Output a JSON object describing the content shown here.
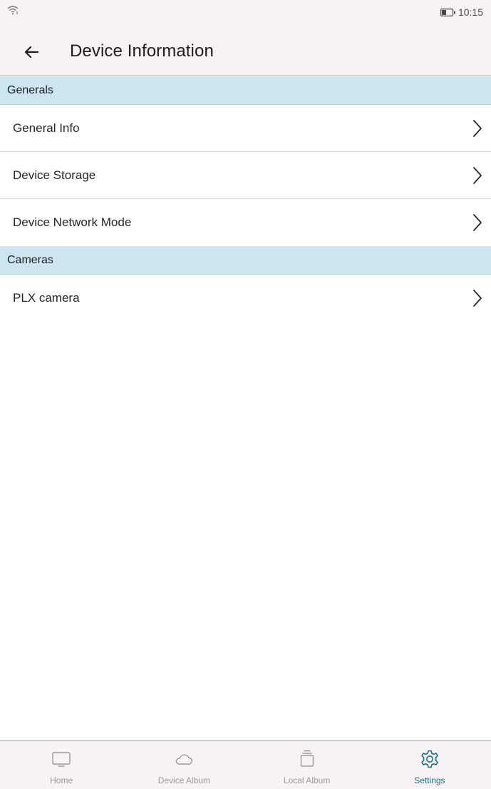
{
  "status_bar": {
    "time": "10:15"
  },
  "header": {
    "title": "Device Information",
    "back_icon": "arrow-left-icon"
  },
  "sections": [
    {
      "title": "Generals",
      "items": [
        {
          "label": "General Info"
        },
        {
          "label": "Device Storage"
        },
        {
          "label": "Device Network Mode"
        }
      ]
    },
    {
      "title": "Cameras",
      "items": [
        {
          "label": "PLX camera"
        }
      ]
    }
  ],
  "bottom_nav": {
    "active": "Settings",
    "items": [
      {
        "label": "Home",
        "icon": "monitor-icon"
      },
      {
        "label": "Device Album",
        "icon": "cloud-icon"
      },
      {
        "label": "Local Album",
        "icon": "album-stack-icon"
      },
      {
        "label": "Settings",
        "icon": "gear-icon"
      }
    ]
  },
  "colors": {
    "active_tab": "#1b6e86",
    "section_bg": "#cde5ee",
    "bar_bg": "#f6f2f6"
  }
}
